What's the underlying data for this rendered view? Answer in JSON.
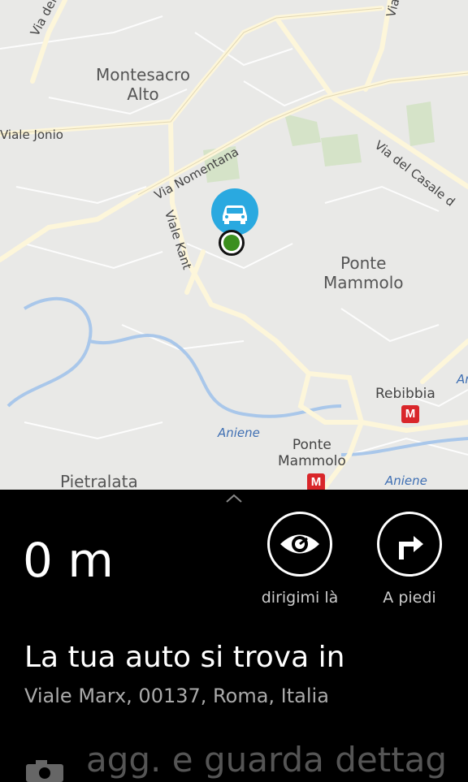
{
  "map": {
    "labels": {
      "via_della": "Via della B",
      "via_top": "Via",
      "montesacro": "Montesacro\nAlto",
      "viale_jonio": "Viale  Jonio",
      "via_nomentana": "Via Nomentana",
      "viale_kant": "Viale Kant",
      "via_casale": "Via del Casale d",
      "ponte_mammolo_area": "Ponte\nMammolo",
      "rebibbia": "Rebibbia",
      "aniene_1": "Aniene",
      "ponte_mammolo_station": "Ponte\nMammolo",
      "aniene_2": "Aniene",
      "pietralata": "Pietralata",
      "edge_an": "An"
    },
    "metro_letter": "M"
  },
  "panel": {
    "distance": "0 m",
    "actions": [
      {
        "label": "dirigimi là",
        "icon": "eye-icon"
      },
      {
        "label": "A piedi",
        "icon": "turn-right-icon"
      }
    ],
    "title": "La tua auto si trova in",
    "address": "Viale Marx, 00137, Roma, Italia",
    "details_label": "agg. e guarda dettag"
  },
  "colors": {
    "map_bg": "#e9e9e7",
    "road": "#fbf7e8",
    "car_pin": "#2aa9e0",
    "location_dot": "#3c8f1e",
    "metro": "#d9262a"
  }
}
